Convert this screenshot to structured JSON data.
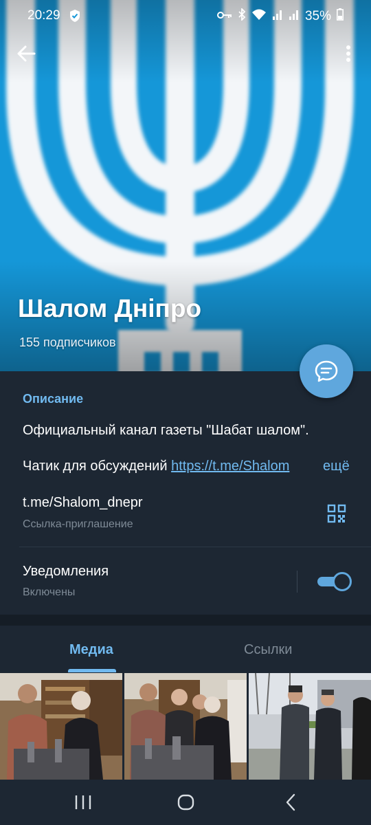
{
  "status_bar": {
    "time": "20:29",
    "battery": "35%",
    "icons": [
      "shield-icon",
      "key-icon",
      "bluetooth-icon",
      "wifi-icon",
      "signal-icon",
      "signal-icon",
      "battery-icon"
    ]
  },
  "header": {
    "channel_name": "Шалом Дніпро",
    "subscribers": "155 подписчиков"
  },
  "info": {
    "section_title": "Описание",
    "description_line1": "Официальный канал газеты \"Шабат шалом\".",
    "description_line2_prefix": "Чатик для обсуждений ",
    "description_link": "https://t.me/Shalom",
    "more_label": "ещё",
    "invite_link": "t.me/Shalom_dnepr",
    "invite_caption": "Ссылка-приглашение",
    "notifications_label": "Уведомления",
    "notifications_status": "Включены",
    "notifications_on": true
  },
  "tabs": [
    {
      "label": "Медиа",
      "active": true
    },
    {
      "label": "Ссылки",
      "active": false
    }
  ],
  "media_thumbnails": [
    "photo",
    "photo",
    "photo"
  ],
  "colors": {
    "accent": "#71baf0",
    "fab": "#5fa7dd",
    "background": "#1d2733",
    "cover_blue": "#1597d8"
  }
}
